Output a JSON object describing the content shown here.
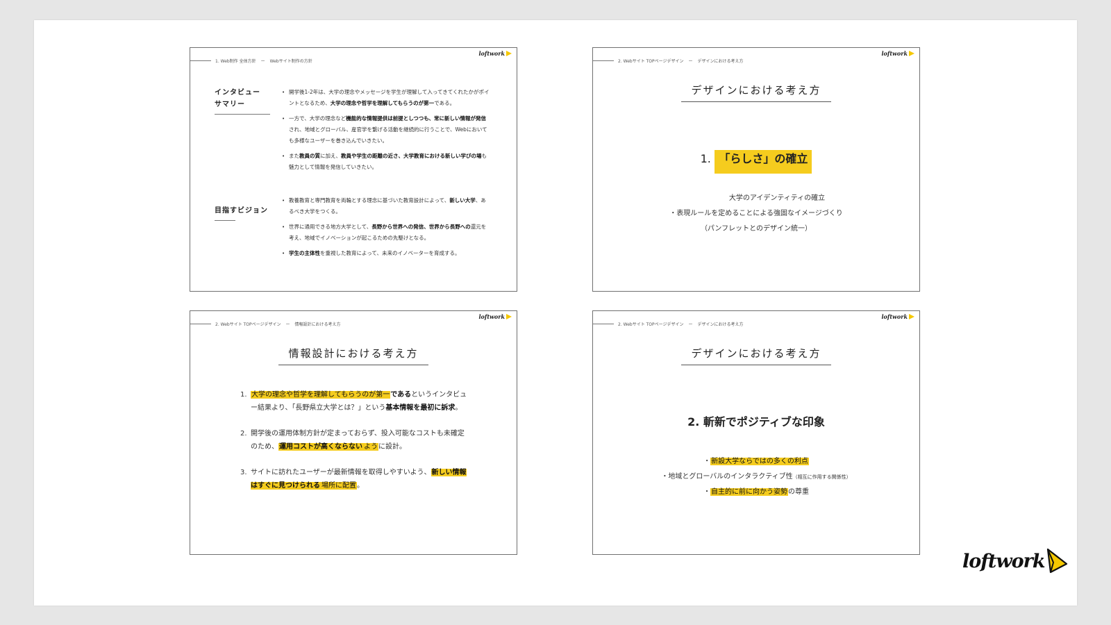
{
  "brand": {
    "logo_text": "loftwork",
    "accent_color": "#f5cc1e"
  },
  "slides": [
    {
      "crumb": {
        "section": "1. Web制作 全体方針",
        "sub": "Webサイト制作の方針"
      },
      "groups": [
        {
          "label": [
            "インタビュー",
            "サマリー"
          ],
          "bullets": [
            {
              "pre": "開学後1-2年は、大学の理念やメッセージを学生が理解して入ってきてくれたかがポイントとなるため、",
              "bold": "大学の理念や哲学を理解してもらうのが第一",
              "post": "である。"
            },
            {
              "pre": "一方で、大学の理念など",
              "bold": "機能的な情報提供は前提としつつも、常に新しい情報が発信",
              "post": "され、地域とグローバル、産官学を繋げる活動を継続的に行うことで、Webにおいても多様なユーザーを巻き込んでいきたい。"
            },
            {
              "pre": "また",
              "bold": "教員の質",
              "mid": "に加え、",
              "bold2": "教員や学生の距離の近さ、大学教育における新しい学びの場",
              "post": "も魅力として情報を発信していきたい。"
            }
          ]
        },
        {
          "label": [
            "目指すビジョン"
          ],
          "bullets": [
            {
              "pre": "教養教育と専門教育を両輪とする理念に基づいた教育設計によって、",
              "bold": "新しい大学",
              "post": "、あるべき大学をつくる。"
            },
            {
              "pre": "世界に通用できる地方大学として、",
              "bold": "長野から世界への発信、世界から長野への",
              "post": "還元を考え、地域でイノベーションが起こるための先駆けとなる。"
            },
            {
              "pre": "",
              "bold": "学生の主体性",
              "post": "を重視した教育によって、未来のイノベーターを育成する。"
            }
          ]
        }
      ]
    },
    {
      "crumb": {
        "section": "2. Webサイト TOPページデザイン",
        "sub": "デザインにおける考え方"
      },
      "title": "デザインにおける考え方",
      "heading": {
        "num": "1.",
        "text": "「らしさ」の確立"
      },
      "lines": [
        "大学のアイデンティティの確立",
        "・表現ルールを定めることによる強固なイメージづくり",
        "（パンフレットとのデザイン統一）"
      ]
    },
    {
      "crumb": {
        "section": "2. Webサイト TOPページデザイン",
        "sub": "情報設計における考え方"
      },
      "title": "情報設計における考え方",
      "items": [
        {
          "num": "1.",
          "hl": "大学の理念や哲学を理解してもらうのが第一",
          "b1": "である",
          "t1": "というインタビュー結果より、「長野県立大学とは？」という",
          "b2": "基本情報を最初に訴求",
          "t2": "。"
        },
        {
          "num": "2.",
          "t1": "開学後の運用体制方針が定まっておらず、投入可能なコストも未確定のため、",
          "hl": "運用コストが高くならない",
          "hl2": "よう",
          "t2": "に設計。"
        },
        {
          "num": "3.",
          "t1": "サイトに訪れたユーザーが最新情報を取得しやすいよう、",
          "hl": "新しい情報はすぐに見つけられる",
          "hl2": "場所に配置",
          "t2": "。"
        }
      ]
    },
    {
      "crumb": {
        "section": "2. Webサイト TOPページデザイン",
        "sub": "デザインにおける考え方"
      },
      "title": "デザインにおける考え方",
      "heading": "2. 斬新でポジティブな印象",
      "points": [
        {
          "pre": "・",
          "hl": "新設大学ならではの多くの利点",
          "post": ""
        },
        {
          "pre": "・地域とグローバルのインタラクティブ性",
          "small": "（相互に作用する関係性）",
          "post": ""
        },
        {
          "pre": "・",
          "hl": "自主的に前に向かう姿勢",
          "post": "の尊重"
        }
      ]
    }
  ]
}
